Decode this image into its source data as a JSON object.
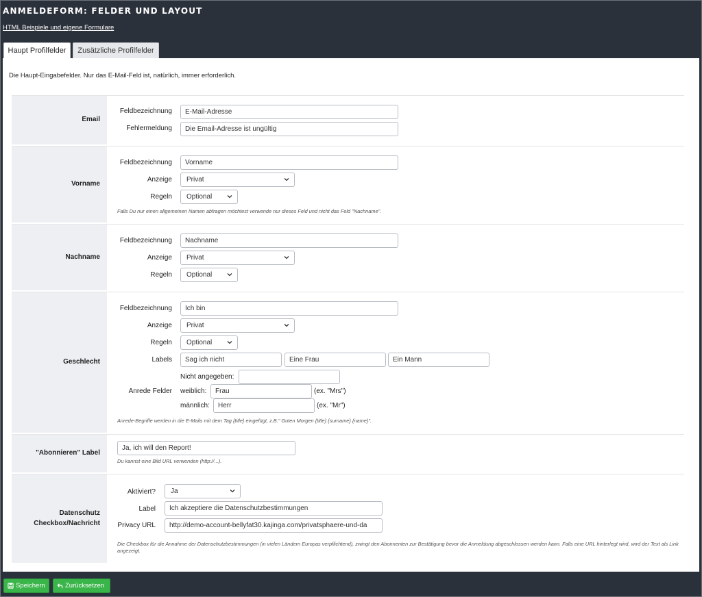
{
  "header": {
    "title": "ANMELDEFORM: FELDER UND LAYOUT",
    "link": "HTML Beispiele und eigene Formulare"
  },
  "tabs": [
    {
      "label": "Haupt Profilfelder",
      "active": true
    },
    {
      "label": "Zusätzliche Profilfelder",
      "active": false
    }
  ],
  "intro": "Die Haupt-Eingabefelder. Nur das E-Mail-Feld ist, natürlich, immer erforderlich.",
  "labels": {
    "feldbezeichnung": "Feldbezeichnung",
    "fehlermeldung": "Fehlermeldung",
    "anzeige": "Anzeige",
    "regeln": "Regeln",
    "labels": "Labels",
    "anrede_felder": "Anrede Felder",
    "aktiviert": "Aktiviert?",
    "label": "Label",
    "privacy_url": "Privacy URL"
  },
  "email": {
    "title": "Email",
    "feldbezeichnung": "E-Mail-Adresse",
    "fehlermeldung": "Die Email-Adresse ist ungültig"
  },
  "vorname": {
    "title": "Vorname",
    "feldbezeichnung": "Vorname",
    "anzeige": "Privat",
    "regeln": "Optional",
    "help": "Falls Du nur einen allgemeinen Namen abfragen möchtest verwende nur dieses Feld und nicht das Feld \"Nachname\"."
  },
  "nachname": {
    "title": "Nachname",
    "feldbezeichnung": "Nachname",
    "anzeige": "Privat",
    "regeln": "Optional"
  },
  "geschlecht": {
    "title": "Geschlecht",
    "feldbezeichnung": "Ich bin",
    "anzeige": "Privat",
    "regeln": "Optional",
    "labels": [
      "Sag ich nicht",
      "Eine Frau",
      "Ein Mann"
    ],
    "anrede": {
      "nicht_label": "Nicht angegeben:",
      "nicht_value": "",
      "weiblich_label": "weiblich:",
      "weiblich_value": "Frau",
      "weiblich_hint": "(ex. \"Mrs\")",
      "maennlich_label": "männlich:",
      "maennlich_value": "Herr",
      "maennlich_hint": "(ex. \"Mr\")"
    },
    "help": "Anrede-Begriffe werden in die E-Mails mit dem Tag {title} eingefügt, z.B.\" Guten Morgen {title} {surname} {name}\"."
  },
  "abonnieren": {
    "title": "\"Abonnieren\" Label",
    "value": "Ja, ich will den Report!",
    "help": "Du kannst eine Bild URL verwenden (http://...)."
  },
  "datenschutz": {
    "title_line1": "Datenschutz",
    "title_line2": "Checkbox/Nachricht",
    "aktiviert": "Ja",
    "label": "Ich akzeptiere die Datenschutzbestimmungen",
    "url": "http://demo-account-bellyfat30.kajinga.com/privatsphaere-und-da",
    "help": "Die Checkbox für die Annahme der Datenschutzbestimmungen (in vielen Ländern Europas verpflichtend), zwingt den Abonnenten zur Bestätigung bevor die Anmeldung abgeschlossen werden kann. Falls eine URL hinterlegt wird, wird der Text als Link angezeigt."
  },
  "buttons": {
    "save": "Speichern",
    "reset": "Zurücksetzen"
  },
  "colors": {
    "background": "#2b313b",
    "button": "#3ab54a",
    "label_bg": "#edeff2"
  },
  "icons": {
    "chevron": "chevron-down-icon",
    "save": "floppy-disk-icon",
    "reset": "undo-arrow-icon"
  }
}
